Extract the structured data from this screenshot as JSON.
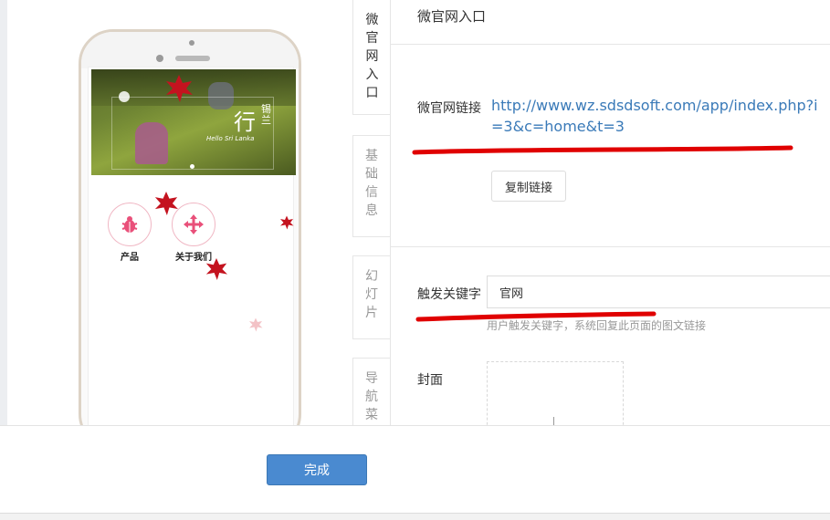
{
  "phone": {
    "banner": {
      "title_char": "行",
      "title_sub": "锡兰",
      "subtitle_en": "Hello Sri Lanka"
    },
    "menu": [
      {
        "label": "产品",
        "icon": "bug-icon"
      },
      {
        "label": "关于我们",
        "icon": "move-arrows-icon"
      }
    ]
  },
  "tabs": [
    {
      "label": "微官网入口",
      "active": true
    },
    {
      "label": "基础信息",
      "active": false
    },
    {
      "label": "幻灯片",
      "active": false
    },
    {
      "label": "导航菜单",
      "active": false
    }
  ],
  "panel": {
    "title": "微官网入口",
    "link_label": "微官网链接",
    "link_url": "http://www.wz.sdsdsoft.com/app/index.php?i=3&c=home&t=3",
    "copy_button": "复制链接",
    "keyword_label": "触发关键字",
    "keyword_value": "官网",
    "keyword_help": "用户触发关键字，系统回复此页面的图文链接",
    "cover_label": "封面"
  },
  "footer": {
    "done_button": "完成"
  },
  "colors": {
    "accent": "#4a8ad0",
    "link": "#3a7ab8",
    "annotation": "#e00000",
    "icon_pink": "#e9507a"
  }
}
